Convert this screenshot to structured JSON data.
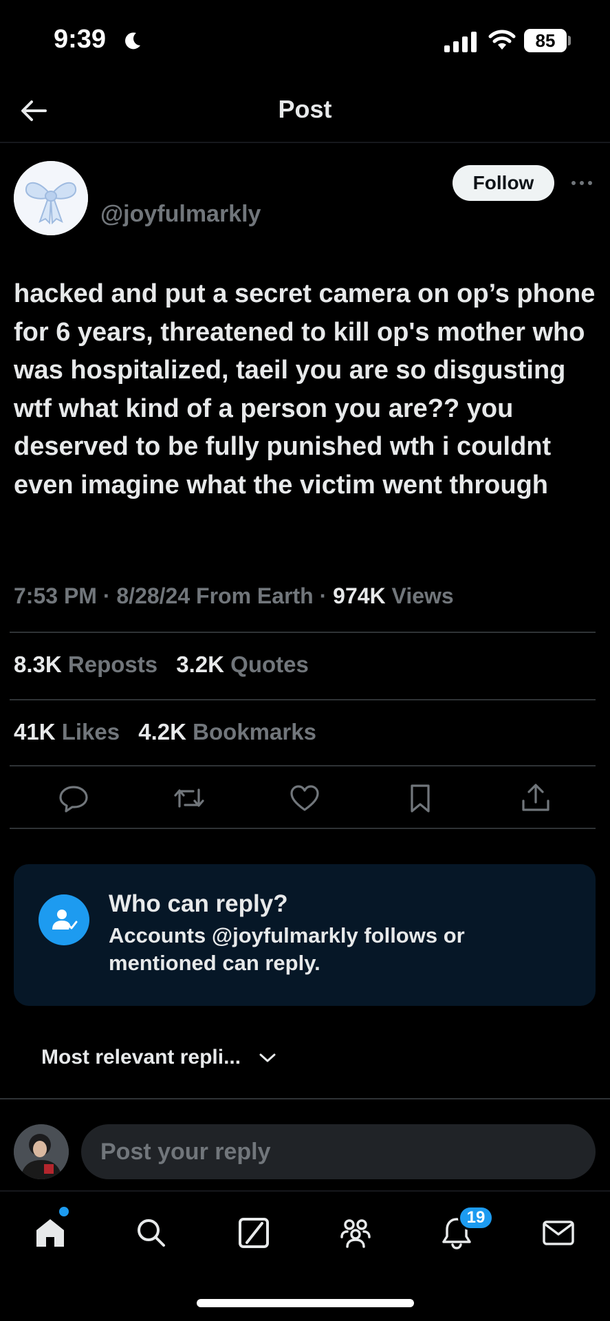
{
  "status_bar": {
    "time": "9:39",
    "battery": "85"
  },
  "header": {
    "title": "Post"
  },
  "post": {
    "username": "@joyfulmarkly",
    "follow_label": "Follow",
    "text": "hacked and put a secret camera on op’s phone for 6 years, threatened to kill op's mother who was hospitalized, taeil you are so disgusting wtf what kind of a person you are?? you deserved to be fully punished wth i couldnt even imagine what the victim went through",
    "time": "7:53 PM",
    "date": "8/28/24",
    "source": "From Earth",
    "views_count": "974K",
    "views_label": "Views",
    "reposts_count": "8.3K",
    "reposts_label": "Reposts",
    "quotes_count": "3.2K",
    "quotes_label": "Quotes",
    "likes_count": "41K",
    "likes_label": "Likes",
    "bookmarks_count": "4.2K",
    "bookmarks_label": "Bookmarks"
  },
  "actions": [
    "reply-icon",
    "repost-icon",
    "like-icon",
    "bookmark-icon",
    "share-icon"
  ],
  "reply_card": {
    "title": "Who can reply?",
    "description": "Accounts @joyfulmarkly follows or mentioned can reply."
  },
  "sort": {
    "label": "Most relevant repli..."
  },
  "composer": {
    "placeholder": "Post your reply"
  },
  "bottom_nav": {
    "items": [
      "home-icon",
      "search-icon",
      "grok-icon",
      "communities-icon",
      "notifications-icon",
      "messages-icon"
    ],
    "notification_count": "19"
  },
  "colors": {
    "accent": "#1d9bf0",
    "secondary_text": "#71767b",
    "primary_text": "#e7e9ea",
    "background": "#000000"
  }
}
